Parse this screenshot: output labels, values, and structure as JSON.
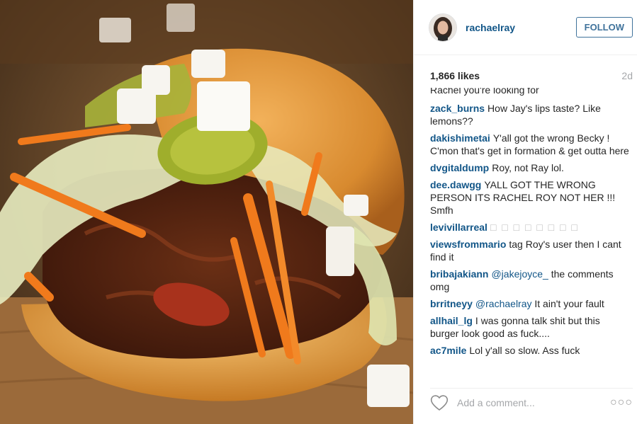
{
  "post": {
    "username": "rachaelray",
    "follow_label": "FOLLOW",
    "likes": "1,866 likes",
    "age": "2d",
    "partial_comment": "Rachel you're looking for",
    "comments": [
      {
        "user": "zack_burns",
        "text": "How Jay's lips taste? Like lemons??"
      },
      {
        "user": "dakishimetai",
        "text": "Y'all got the wrong Becky ! C'mon that's get in formation & get outta here"
      },
      {
        "user": "dvgitaldump",
        "text": "Roy, not Ray lol."
      },
      {
        "user": "dee.dawgg",
        "text": "YALL GOT THE WRONG PERSON ITS RACHEL ROY NOT HER !!! Smfh"
      },
      {
        "user": "levivillarreal",
        "text": "□ □ □ □ □ □ □ □"
      },
      {
        "user": "viewsfrommario",
        "text": "tag Roy's user then I cant find it"
      },
      {
        "user": "bribajakiann",
        "mention": "@jakejoyce_",
        "text": "the comments omg"
      },
      {
        "user": "brritneyy",
        "mention": "@rachaelray",
        "text": "It ain't your fault"
      },
      {
        "user": "allhail_lg",
        "text": "I was gonna talk shit but this burger look good as fuck...."
      },
      {
        "user": "ac7mile",
        "text": "Lol y'all so slow. Ass fuck"
      }
    ],
    "comment_placeholder": "Add a comment...",
    "more_label": "○○○"
  },
  "icons": {
    "heart": "heart-outline-icon",
    "more": "more-options-icon"
  },
  "colors": {
    "username_blue": "#125688",
    "follow_blue": "#3f729b",
    "muted_gray": "#a5a7aa"
  }
}
